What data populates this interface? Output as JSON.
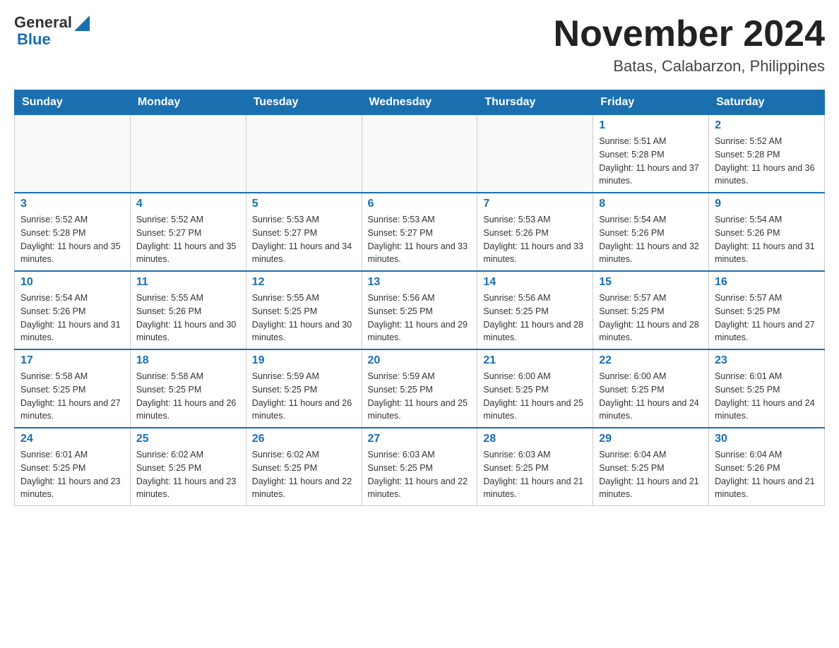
{
  "logo": {
    "general": "General",
    "blue": "Blue"
  },
  "title": "November 2024",
  "location": "Batas, Calabarzon, Philippines",
  "days_of_week": [
    "Sunday",
    "Monday",
    "Tuesday",
    "Wednesday",
    "Thursday",
    "Friday",
    "Saturday"
  ],
  "weeks": [
    [
      {
        "day": "",
        "info": ""
      },
      {
        "day": "",
        "info": ""
      },
      {
        "day": "",
        "info": ""
      },
      {
        "day": "",
        "info": ""
      },
      {
        "day": "",
        "info": ""
      },
      {
        "day": "1",
        "info": "Sunrise: 5:51 AM\nSunset: 5:28 PM\nDaylight: 11 hours and 37 minutes."
      },
      {
        "day": "2",
        "info": "Sunrise: 5:52 AM\nSunset: 5:28 PM\nDaylight: 11 hours and 36 minutes."
      }
    ],
    [
      {
        "day": "3",
        "info": "Sunrise: 5:52 AM\nSunset: 5:28 PM\nDaylight: 11 hours and 35 minutes."
      },
      {
        "day": "4",
        "info": "Sunrise: 5:52 AM\nSunset: 5:27 PM\nDaylight: 11 hours and 35 minutes."
      },
      {
        "day": "5",
        "info": "Sunrise: 5:53 AM\nSunset: 5:27 PM\nDaylight: 11 hours and 34 minutes."
      },
      {
        "day": "6",
        "info": "Sunrise: 5:53 AM\nSunset: 5:27 PM\nDaylight: 11 hours and 33 minutes."
      },
      {
        "day": "7",
        "info": "Sunrise: 5:53 AM\nSunset: 5:26 PM\nDaylight: 11 hours and 33 minutes."
      },
      {
        "day": "8",
        "info": "Sunrise: 5:54 AM\nSunset: 5:26 PM\nDaylight: 11 hours and 32 minutes."
      },
      {
        "day": "9",
        "info": "Sunrise: 5:54 AM\nSunset: 5:26 PM\nDaylight: 11 hours and 31 minutes."
      }
    ],
    [
      {
        "day": "10",
        "info": "Sunrise: 5:54 AM\nSunset: 5:26 PM\nDaylight: 11 hours and 31 minutes."
      },
      {
        "day": "11",
        "info": "Sunrise: 5:55 AM\nSunset: 5:26 PM\nDaylight: 11 hours and 30 minutes."
      },
      {
        "day": "12",
        "info": "Sunrise: 5:55 AM\nSunset: 5:25 PM\nDaylight: 11 hours and 30 minutes."
      },
      {
        "day": "13",
        "info": "Sunrise: 5:56 AM\nSunset: 5:25 PM\nDaylight: 11 hours and 29 minutes."
      },
      {
        "day": "14",
        "info": "Sunrise: 5:56 AM\nSunset: 5:25 PM\nDaylight: 11 hours and 28 minutes."
      },
      {
        "day": "15",
        "info": "Sunrise: 5:57 AM\nSunset: 5:25 PM\nDaylight: 11 hours and 28 minutes."
      },
      {
        "day": "16",
        "info": "Sunrise: 5:57 AM\nSunset: 5:25 PM\nDaylight: 11 hours and 27 minutes."
      }
    ],
    [
      {
        "day": "17",
        "info": "Sunrise: 5:58 AM\nSunset: 5:25 PM\nDaylight: 11 hours and 27 minutes."
      },
      {
        "day": "18",
        "info": "Sunrise: 5:58 AM\nSunset: 5:25 PM\nDaylight: 11 hours and 26 minutes."
      },
      {
        "day": "19",
        "info": "Sunrise: 5:59 AM\nSunset: 5:25 PM\nDaylight: 11 hours and 26 minutes."
      },
      {
        "day": "20",
        "info": "Sunrise: 5:59 AM\nSunset: 5:25 PM\nDaylight: 11 hours and 25 minutes."
      },
      {
        "day": "21",
        "info": "Sunrise: 6:00 AM\nSunset: 5:25 PM\nDaylight: 11 hours and 25 minutes."
      },
      {
        "day": "22",
        "info": "Sunrise: 6:00 AM\nSunset: 5:25 PM\nDaylight: 11 hours and 24 minutes."
      },
      {
        "day": "23",
        "info": "Sunrise: 6:01 AM\nSunset: 5:25 PM\nDaylight: 11 hours and 24 minutes."
      }
    ],
    [
      {
        "day": "24",
        "info": "Sunrise: 6:01 AM\nSunset: 5:25 PM\nDaylight: 11 hours and 23 minutes."
      },
      {
        "day": "25",
        "info": "Sunrise: 6:02 AM\nSunset: 5:25 PM\nDaylight: 11 hours and 23 minutes."
      },
      {
        "day": "26",
        "info": "Sunrise: 6:02 AM\nSunset: 5:25 PM\nDaylight: 11 hours and 22 minutes."
      },
      {
        "day": "27",
        "info": "Sunrise: 6:03 AM\nSunset: 5:25 PM\nDaylight: 11 hours and 22 minutes."
      },
      {
        "day": "28",
        "info": "Sunrise: 6:03 AM\nSunset: 5:25 PM\nDaylight: 11 hours and 21 minutes."
      },
      {
        "day": "29",
        "info": "Sunrise: 6:04 AM\nSunset: 5:25 PM\nDaylight: 11 hours and 21 minutes."
      },
      {
        "day": "30",
        "info": "Sunrise: 6:04 AM\nSunset: 5:26 PM\nDaylight: 11 hours and 21 minutes."
      }
    ]
  ]
}
